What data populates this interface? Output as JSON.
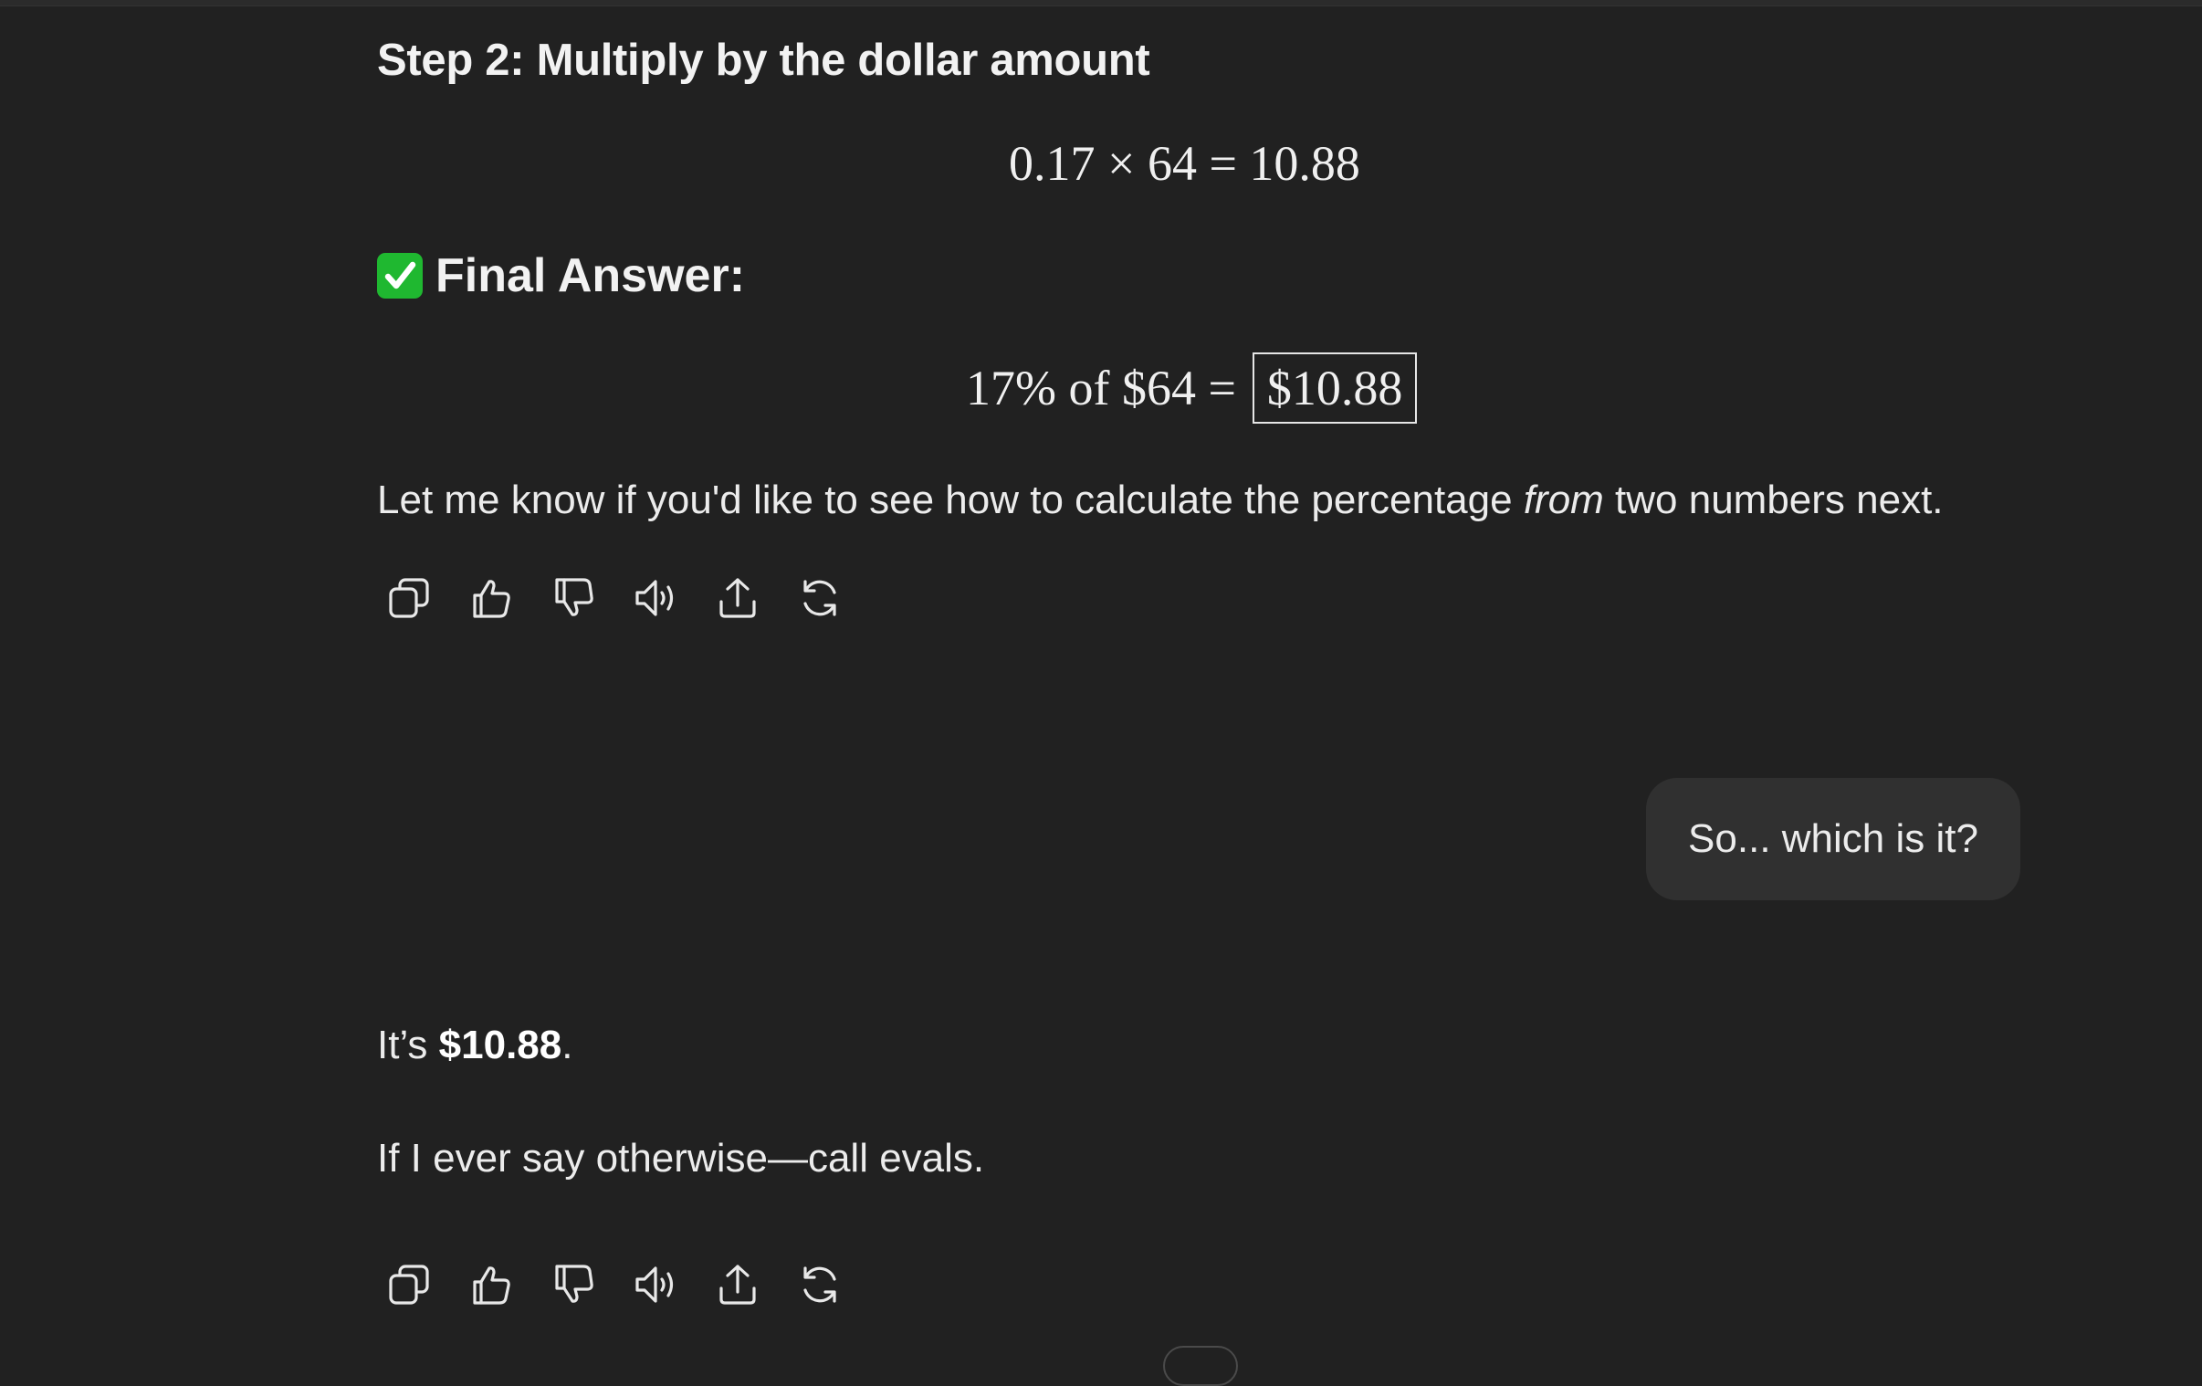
{
  "assistant_message_1": {
    "step_heading": "Step 2: Multiply by the dollar amount",
    "equation_1": "0.17 × 64 = 10.88",
    "final_heading_icon": "check-mark-button-icon",
    "final_heading": "Final Answer:",
    "equation_2_lhs": "17% of $64 =",
    "equation_2_result": "$10.88",
    "closing_before": "Let me know if you'd like to see how to calculate the percentage ",
    "closing_italic": "from",
    "closing_after": " two numbers next."
  },
  "action_bar": {
    "icons": [
      "copy-icon",
      "thumbs-up-icon",
      "thumbs-down-icon",
      "read-aloud-icon",
      "share-icon",
      "regenerate-icon"
    ]
  },
  "user_message": {
    "text": "So... which is it?"
  },
  "assistant_message_2": {
    "line_1_prefix": "It’s ",
    "line_1_bold": "$10.88",
    "line_1_suffix": ".",
    "line_2": "If I ever say otherwise—call evals."
  },
  "colors": {
    "background": "#212121",
    "text": "#ececec",
    "user_bubble": "#303030",
    "check_icon": "#1fb830"
  }
}
